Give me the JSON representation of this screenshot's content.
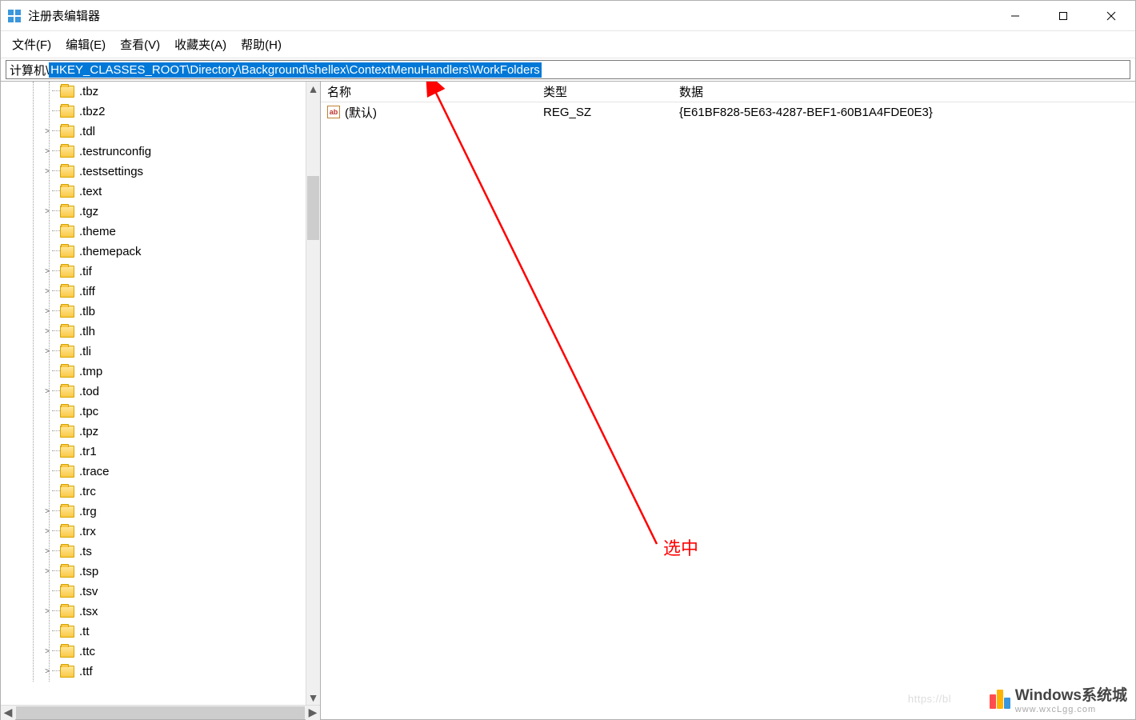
{
  "window": {
    "title": "注册表编辑器"
  },
  "menu": {
    "file": "文件(F)",
    "edit": "编辑(E)",
    "view": "查看(V)",
    "favorites": "收藏夹(A)",
    "help": "帮助(H)"
  },
  "address": {
    "prefix": "计算机\\",
    "path": "HKEY_CLASSES_ROOT\\Directory\\Background\\shellex\\ContextMenuHandlers\\WorkFolders"
  },
  "tree": {
    "items": [
      {
        "label": ".tbz",
        "expander": "",
        "indent": 76
      },
      {
        "label": ".tbz2",
        "expander": "",
        "indent": 76
      },
      {
        "label": ".tdl",
        "expander": ">",
        "indent": 76
      },
      {
        "label": ".testrunconfig",
        "expander": ">",
        "indent": 76
      },
      {
        "label": ".testsettings",
        "expander": ">",
        "indent": 76
      },
      {
        "label": ".text",
        "expander": "",
        "indent": 76
      },
      {
        "label": ".tgz",
        "expander": ">",
        "indent": 76
      },
      {
        "label": ".theme",
        "expander": "",
        "indent": 76
      },
      {
        "label": ".themepack",
        "expander": "",
        "indent": 76
      },
      {
        "label": ".tif",
        "expander": ">",
        "indent": 76
      },
      {
        "label": ".tiff",
        "expander": ">",
        "indent": 76
      },
      {
        "label": ".tlb",
        "expander": ">",
        "indent": 76
      },
      {
        "label": ".tlh",
        "expander": ">",
        "indent": 76
      },
      {
        "label": ".tli",
        "expander": ">",
        "indent": 76
      },
      {
        "label": ".tmp",
        "expander": "",
        "indent": 76
      },
      {
        "label": ".tod",
        "expander": ">",
        "indent": 76
      },
      {
        "label": ".tpc",
        "expander": "",
        "indent": 76
      },
      {
        "label": ".tpz",
        "expander": "",
        "indent": 76
      },
      {
        "label": ".tr1",
        "expander": "",
        "indent": 76
      },
      {
        "label": ".trace",
        "expander": "",
        "indent": 76
      },
      {
        "label": ".trc",
        "expander": "",
        "indent": 76
      },
      {
        "label": ".trg",
        "expander": ">",
        "indent": 76
      },
      {
        "label": ".trx",
        "expander": ">",
        "indent": 76
      },
      {
        "label": ".ts",
        "expander": ">",
        "indent": 76
      },
      {
        "label": ".tsp",
        "expander": ">",
        "indent": 76
      },
      {
        "label": ".tsv",
        "expander": "",
        "indent": 76
      },
      {
        "label": ".tsx",
        "expander": ">",
        "indent": 76
      },
      {
        "label": ".tt",
        "expander": "",
        "indent": 76
      },
      {
        "label": ".ttc",
        "expander": ">",
        "indent": 76
      },
      {
        "label": ".ttf",
        "expander": ">",
        "indent": 76
      }
    ]
  },
  "details": {
    "columns": {
      "name": "名称",
      "type": "类型",
      "data": "数据"
    },
    "rows": [
      {
        "name": "(默认)",
        "type": "REG_SZ",
        "data": "{E61BF828-5E63-4287-BEF1-60B1A4FDE0E3}"
      }
    ]
  },
  "annotation": {
    "label": "选中"
  },
  "watermark": {
    "brand": "Windows系统城",
    "url": "www.wxcLgg.com"
  },
  "icons": {
    "value_string": "ab"
  },
  "scroll_arrows": {
    "left": "◀",
    "right": "▶",
    "up": "▲",
    "down": "▼"
  }
}
